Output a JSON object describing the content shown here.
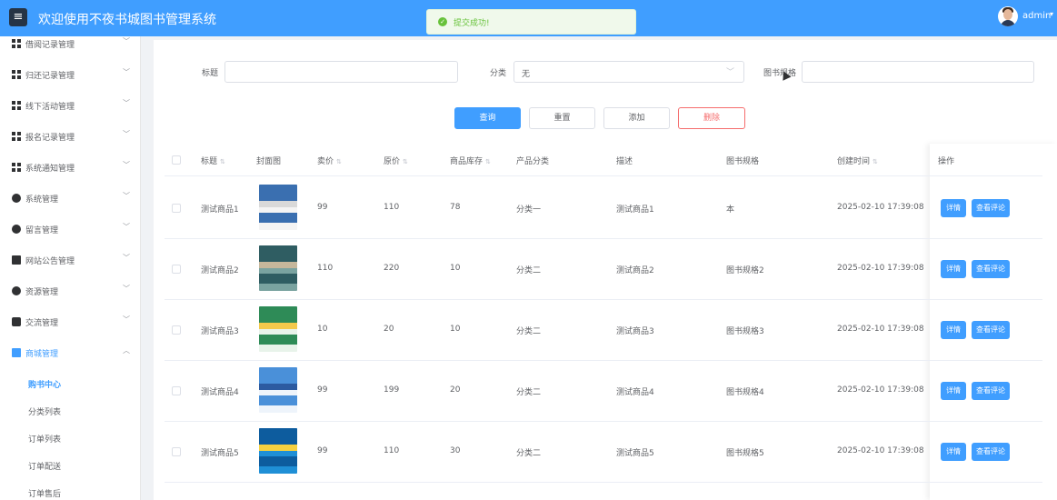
{
  "header": {
    "menu_icon": "hamburger-icon",
    "title": "欢迎使用不夜书城图书管理系统",
    "user": "admin",
    "user_caret_icon": "caret-down-icon",
    "bg_color": "#409eff"
  },
  "toast": {
    "icon": "check-circle-icon",
    "text": "提交成功!"
  },
  "sidebar": {
    "items": [
      {
        "label": "借阅记录管理",
        "icon": "grid-icon"
      },
      {
        "label": "归还记录管理",
        "icon": "grid-icon"
      },
      {
        "label": "线下活动管理",
        "icon": "grid-icon"
      },
      {
        "label": "报名记录管理",
        "icon": "grid-icon"
      },
      {
        "label": "系统通知管理",
        "icon": "grid-icon"
      },
      {
        "label": "系统管理",
        "icon": "gear-icon"
      },
      {
        "label": "留言管理",
        "icon": "gear-icon"
      },
      {
        "label": "网站公告管理",
        "icon": "document-icon"
      },
      {
        "label": "资源管理",
        "icon": "plus-circle-icon"
      },
      {
        "label": "交流管理",
        "icon": "chat-icon"
      },
      {
        "label": "商城管理",
        "icon": "shop-icon"
      }
    ],
    "sub_items": [
      {
        "label": "购书中心",
        "active": true
      },
      {
        "label": "分类列表"
      },
      {
        "label": "订单列表"
      },
      {
        "label": "订单配送"
      },
      {
        "label": "订单售后"
      }
    ]
  },
  "filters": {
    "title_label": "标题",
    "title_value": "",
    "category_label": "分类",
    "category_value": "无",
    "spec_label": "图书规格",
    "spec_value": ""
  },
  "actions": {
    "search": "查询",
    "reset": "重置",
    "add": "添加",
    "delete": "删除"
  },
  "table": {
    "columns": [
      "标题",
      "封面图",
      "卖价",
      "原价",
      "商品库存",
      "产品分类",
      "描述",
      "图书规格",
      "创建时间",
      "操作"
    ],
    "detail_label": "详情",
    "review_label": "查看评论",
    "rows": [
      {
        "title": "测试商品1",
        "price": "99",
        "original": "110",
        "stock": "78",
        "category": "分类一",
        "desc": "测试商品1",
        "spec": "本",
        "created": "2025-02-10 17:39:08",
        "cover_colors": [
          "#f4f4f4",
          "#3a6fb0",
          "#d9d9d9"
        ]
      },
      {
        "title": "测试商品2",
        "price": "110",
        "original": "220",
        "stock": "10",
        "category": "分类二",
        "desc": "测试商品2",
        "spec": "图书规格2",
        "created": "2025-02-10 17:39:08",
        "cover_colors": [
          "#7aa3a0",
          "#2f5d62",
          "#c6b79b"
        ]
      },
      {
        "title": "测试商品3",
        "price": "10",
        "original": "20",
        "stock": "10",
        "category": "分类二",
        "desc": "测试商品3",
        "spec": "图书规格3",
        "created": "2025-02-10 17:39:08",
        "cover_colors": [
          "#e8f3ea",
          "#2e8b57",
          "#f2c94c"
        ]
      },
      {
        "title": "测试商品4",
        "price": "99",
        "original": "199",
        "stock": "20",
        "category": "分类二",
        "desc": "测试商品4",
        "spec": "图书规格4",
        "created": "2025-02-10 17:39:08",
        "cover_colors": [
          "#eef4fb",
          "#4a90d9",
          "#2c5aa0"
        ]
      },
      {
        "title": "测试商品5",
        "price": "99",
        "original": "110",
        "stock": "30",
        "category": "分类二",
        "desc": "测试商品5",
        "spec": "图书规格5",
        "created": "2025-02-10 17:39:08",
        "cover_colors": [
          "#1f8fd6",
          "#0d5c9e",
          "#f5d040"
        ]
      }
    ]
  }
}
